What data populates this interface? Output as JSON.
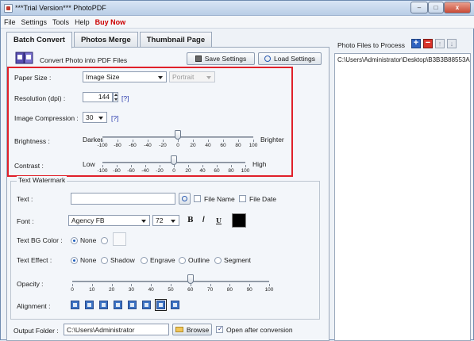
{
  "window": {
    "title": "***Trial Version*** PhotoPDF",
    "controls": {
      "minimize": "–",
      "maximize": "□",
      "close": "x"
    }
  },
  "menu": [
    "File",
    "Settings",
    "Tools",
    "Help",
    "Buy Now"
  ],
  "tabs": [
    "Batch Convert",
    "Photos Merge",
    "Thumbnail Page"
  ],
  "header": {
    "caption": "Convert Photo into PDF Files",
    "save_settings": "Save Settings",
    "load_settings": "Load Settings"
  },
  "settings": {
    "paper_size": {
      "label": "Paper Size :",
      "value": "Image Size",
      "orientation": "Portrait"
    },
    "resolution": {
      "label": "Resolution (dpi) :",
      "value": "144",
      "help": "[?]"
    },
    "compression": {
      "label": "Image Compression :",
      "value": "30",
      "help": "[?]"
    },
    "brightness": {
      "label": "Brightness :",
      "min_label": "Darker",
      "max_label": "Brighter",
      "ticks": [
        "-100",
        "-80",
        "-60",
        "-40",
        "-20",
        "0",
        "20",
        "40",
        "60",
        "80",
        "100"
      ],
      "value": 0
    },
    "contrast": {
      "label": "Contrast :",
      "min_label": "Low",
      "max_label": "High",
      "ticks": [
        "-100",
        "-80",
        "-60",
        "-40",
        "-20",
        "0",
        "20",
        "40",
        "60",
        "80",
        "100"
      ],
      "value": 0
    }
  },
  "watermark": {
    "legend": "Text Watermark",
    "text": {
      "label": "Text :",
      "value": "",
      "file_name": "File Name",
      "file_date": "File Date"
    },
    "font": {
      "label": "Font :",
      "family": "Agency FB",
      "size": "72",
      "bold": "B",
      "italic": "/",
      "underline": "U",
      "color": "#000000"
    },
    "bg_color": {
      "label": "Text BG Color :",
      "none": "None"
    },
    "effect": {
      "label": "Text Effect :",
      "options": [
        "None",
        "Shadow",
        "Engrave",
        "Outline",
        "Segment"
      ]
    },
    "opacity": {
      "label": "Opacity :",
      "ticks": [
        "0",
        "10",
        "20",
        "30",
        "40",
        "50",
        "60",
        "70",
        "80",
        "90",
        "100"
      ],
      "value": 60
    },
    "alignment": {
      "label": "Alignment :",
      "selected_index": 6
    }
  },
  "output": {
    "label": "Output Folder :",
    "path": "C:\\Users\\Administrator",
    "browse": "Browse",
    "open_after": "Open after conversion"
  },
  "photo_files": {
    "label": "Photo Files to Process",
    "items": [
      "C:\\Users\\Administrator\\Desktop\\B3B3B88553A"
    ]
  },
  "colors": {
    "highlight_box": "#e0202a",
    "buy_now": "#cc0000"
  }
}
